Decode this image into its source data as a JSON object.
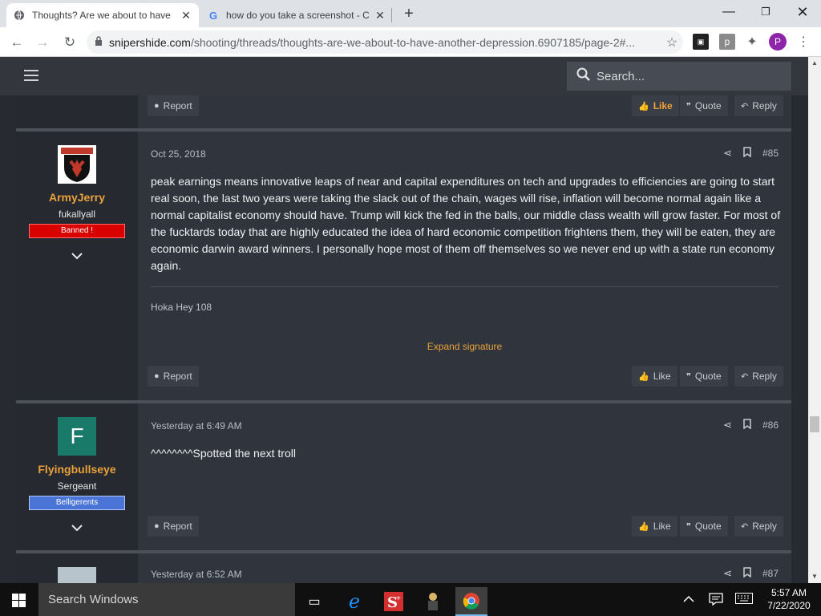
{
  "browser": {
    "tabs": [
      {
        "title": "Thoughts? Are we about to have",
        "active": true
      },
      {
        "title": "how do you take a screenshot - C",
        "active": false
      }
    ],
    "url_host": "snipershide.com",
    "url_path": "/shooting/threads/thoughts-are-we-about-to-have-another-depression.6907185/page-2#...",
    "profile_initial": "P",
    "ext_p": "p"
  },
  "site": {
    "search_placeholder": "Search..."
  },
  "top_actions": {
    "report": "Report",
    "like": "Like",
    "quote": "Quote",
    "reply": "Reply"
  },
  "posts": [
    {
      "date": "Oct 25, 2018",
      "number": "#85",
      "username": "ArmyJerry",
      "user_title": "fukallyall",
      "badge": "Banned !",
      "text": "peak earnings means innovative leaps of near and capital expenditures on tech and upgrades to efficiencies are going to start real soon, the last two years were taking the slack out of the chain, wages will rise, inflation will become normal again like a normal capitalist economy should have. Trump will kick the fed in the balls, our middle class wealth will grow faster. For most of the fucktards today that are highly educated the idea of hard economic competition frightens them, they will be eaten, they are economic darwin award winners. I personally hope most of them off themselves so we never end up with a state run economy again.",
      "signature": "Hoka Hey 108",
      "expand": "Expand signature",
      "report": "Report",
      "like": "Like",
      "quote": "Quote",
      "reply": "Reply"
    },
    {
      "date": "Yesterday at 6:49 AM",
      "number": "#86",
      "username": "Flyingbullseye",
      "avatar_letter": "F",
      "user_title": "Sergeant",
      "badge": "Belligerents",
      "text": "^^^^^^^^Spotted the next troll",
      "report": "Report",
      "like": "Like",
      "quote": "Quote",
      "reply": "Reply"
    },
    {
      "date": "Yesterday at 6:52 AM",
      "number": "#87"
    }
  ],
  "taskbar": {
    "search": "Search Windows",
    "time": "5:57 AM",
    "date": "7/22/2020"
  }
}
